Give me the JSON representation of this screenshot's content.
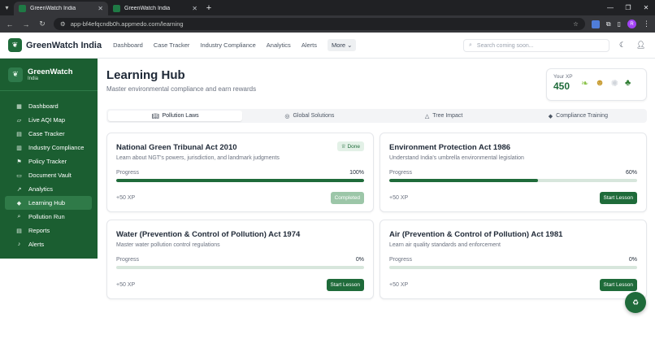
{
  "browser": {
    "tabs": [
      {
        "title": "GreenWatch India",
        "active": true
      },
      {
        "title": "GreenWatch India",
        "active": false
      }
    ],
    "url": "app-bf4efqcndb0h.appmedo.com/learning",
    "profile_initial": "R"
  },
  "topnav": {
    "brand": "GreenWatch India",
    "links": [
      "Dashboard",
      "Case Tracker",
      "Industry Compliance",
      "Analytics",
      "Alerts"
    ],
    "more_label": "More",
    "search_placeholder": "Search coming soon..."
  },
  "sidebar": {
    "title": "GreenWatch",
    "subtitle": "India",
    "items": [
      {
        "label": "Dashboard",
        "icon": "grid-icon"
      },
      {
        "label": "Live AQI Map",
        "icon": "map-icon"
      },
      {
        "label": "Case Tracker",
        "icon": "file-icon"
      },
      {
        "label": "Industry Compliance",
        "icon": "building-icon"
      },
      {
        "label": "Policy Tracker",
        "icon": "flag-icon"
      },
      {
        "label": "Document Vault",
        "icon": "folder-icon"
      },
      {
        "label": "Analytics",
        "icon": "chart-icon"
      },
      {
        "label": "Learning Hub",
        "icon": "graduation-icon",
        "active": true
      },
      {
        "label": "Pollution Run",
        "icon": "search-icon"
      },
      {
        "label": "Reports",
        "icon": "report-icon"
      },
      {
        "label": "Alerts",
        "icon": "bell-icon"
      }
    ]
  },
  "page": {
    "title": "Learning Hub",
    "subtitle": "Master environmental compliance and earn rewards"
  },
  "xp": {
    "label": "Your XP",
    "value": "450"
  },
  "tabs": [
    {
      "label": "Pollution Laws",
      "icon": "book-icon",
      "active": true
    },
    {
      "label": "Global Solutions",
      "icon": "globe-icon"
    },
    {
      "label": "Tree Impact",
      "icon": "tree-icon"
    },
    {
      "label": "Compliance Training",
      "icon": "graduation-icon"
    }
  ],
  "courses": [
    {
      "title": "National Green Tribunal Act 2010",
      "desc": "Learn about NGT's powers, jurisdiction, and landmark judgments",
      "progress_label": "Progress",
      "pct_text": "100%",
      "pct": 100,
      "xp": "+50 XP",
      "button": "Completed",
      "badge": "Done"
    },
    {
      "title": "Environment Protection Act 1986",
      "desc": "Understand India's umbrella environmental legislation",
      "progress_label": "Progress",
      "pct_text": "60%",
      "pct": 60,
      "xp": "+50 XP",
      "button": "Start Lesson"
    },
    {
      "title": "Water (Prevention & Control of Pollution) Act 1974",
      "desc": "Master water pollution control regulations",
      "progress_label": "Progress",
      "pct_text": "0%",
      "pct": 0,
      "xp": "+50 XP",
      "button": "Start Lesson"
    },
    {
      "title": "Air (Prevention & Control of Pollution) Act 1981",
      "desc": "Learn air quality standards and enforcement",
      "progress_label": "Progress",
      "pct_text": "0%",
      "pct": 0,
      "xp": "+50 XP",
      "button": "Start Lesson"
    }
  ],
  "colors": {
    "brand_green": "#1f6b3a",
    "sidebar_bg": "#1b5e31"
  }
}
